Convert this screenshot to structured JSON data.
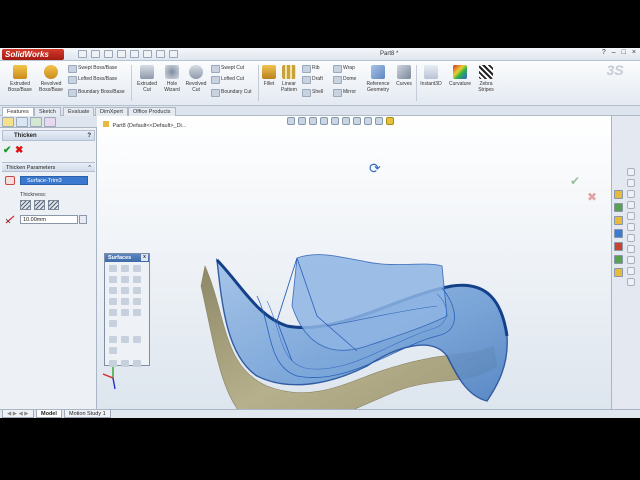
{
  "app": {
    "logo_text": "SolidWorks",
    "document_title": "Part8 *",
    "window_controls": [
      "?",
      "–",
      "□",
      "×"
    ]
  },
  "ribbon": {
    "large_buttons": [
      {
        "label": "Extruded\nBoss/Base",
        "icon": "extruded-boss-icon"
      },
      {
        "label": "Revolved\nBoss/Base",
        "icon": "revolved-boss-icon"
      },
      {
        "label": "Extruded\nCut",
        "icon": "extruded-cut-icon"
      },
      {
        "label": "Hole\nWizard",
        "icon": "hole-wizard-icon"
      },
      {
        "label": "Revolved\nCut",
        "icon": "revolved-cut-icon"
      },
      {
        "label": "Fillet",
        "icon": "fillet-icon"
      },
      {
        "label": "Linear\nPattern",
        "icon": "linear-pattern-icon"
      },
      {
        "label": "Reference\nGeometry",
        "icon": "reference-geometry-icon"
      },
      {
        "label": "Curves",
        "icon": "curves-icon"
      },
      {
        "label": "Instant3D",
        "icon": "instant3d-icon"
      },
      {
        "label": "Curvature",
        "icon": "curvature-icon"
      },
      {
        "label": "Zebra\nStripes",
        "icon": "zebra-stripes-icon"
      }
    ],
    "small_buttons": {
      "boss": [
        "Swept Boss/Base",
        "Lofted Boss/Base",
        "Boundary Boss/Base"
      ],
      "cut": [
        "Swept Cut",
        "Lofted Cut",
        "Boundary Cut"
      ],
      "features": [
        "Rib",
        "Draft",
        "Shell"
      ],
      "misc": [
        "Wrap",
        "Dome",
        "Mirror"
      ]
    }
  },
  "command_tabs": [
    "Features",
    "Sketch",
    "Evaluate",
    "DimXpert",
    "Office Products"
  ],
  "property_manager": {
    "title": "Thicken",
    "ok_icon": "check-icon",
    "cancel_icon": "close-icon",
    "group_title": "Thicken Parameters",
    "selected_surface": "Surface-Trim3",
    "thickness_label": "Thickness:",
    "thickness_value": "10.00mm"
  },
  "viewport": {
    "tree_flyout": "Part8 (Default<<Default>_Di..."
  },
  "surfaces_toolbar": {
    "title": "Surfaces",
    "close": "x"
  },
  "bottom_tabs": [
    "Model",
    "Motion Study 1"
  ],
  "colors": {
    "accent": "#3b79d1",
    "surface_blue": "#6f9ed6",
    "thickened_tan": "#a7a07c"
  }
}
